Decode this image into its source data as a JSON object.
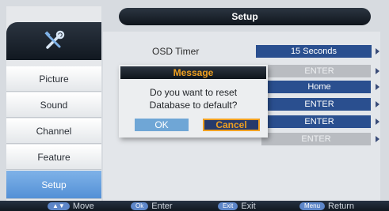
{
  "header": {
    "title": "Setup"
  },
  "sidebar": {
    "logo_icon": "tools-icon",
    "items": [
      {
        "label": "Picture",
        "active": false
      },
      {
        "label": "Sound",
        "active": false
      },
      {
        "label": "Channel",
        "active": false
      },
      {
        "label": "Feature",
        "active": false
      },
      {
        "label": "Setup",
        "active": true
      }
    ]
  },
  "settings": {
    "osd_label": "OSD Timer",
    "osd_value": "15 Seconds",
    "row2_value": "ENTER",
    "row3_value": "Home",
    "row4_value": "ENTER",
    "row5_value": "ENTER",
    "row6_value": "ENTER"
  },
  "dialog": {
    "title": "Message",
    "line1": "Do you want to reset",
    "line2": "Database to default?",
    "ok_label": "OK",
    "cancel_label": "Cancel"
  },
  "footer": {
    "move_key": "▲▼",
    "move_label": "Move",
    "enter_key": "Ok",
    "enter_label": "Enter",
    "exit_key": "Exit",
    "exit_label": "Exit",
    "return_key": "Menu",
    "return_label": "Return"
  },
  "colors": {
    "accent": "#2a4f8f",
    "highlight": "#f0a020",
    "active_tab": "#5390d6"
  }
}
